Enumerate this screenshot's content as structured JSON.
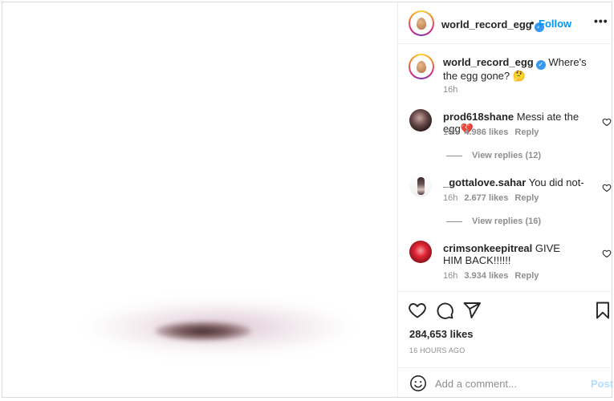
{
  "post": {
    "username": "world_record_egg",
    "verified_mark": "✓",
    "separator": "•",
    "follow_label": "Follow",
    "more_label": "•••",
    "caption_text": "Where's the egg gone? 🤔",
    "caption_time": "16h"
  },
  "comments": [
    {
      "username": "prod618shane",
      "text": "Messi ate the egg💔",
      "time": "16h",
      "likes": "4.986 likes",
      "reply_label": "Reply",
      "view_replies": "View replies (12)"
    },
    {
      "username": "_gottalove.sahar",
      "text": "You did not-",
      "time": "16h",
      "likes": "2.677 likes",
      "reply_label": "Reply",
      "view_replies": "View replies (16)"
    },
    {
      "username": "crimsonkeepitreal",
      "text": "GIVE HIM BACK!!!!!!",
      "time": "16h",
      "likes": "3.934 likes",
      "reply_label": "Reply"
    }
  ],
  "actions": {
    "likes_count": "284,653 likes",
    "time_ago": "16 HOURS AGO"
  },
  "add_comment": {
    "placeholder": "Add a comment...",
    "post_label": "Post"
  },
  "colors": {
    "link_blue": "#0095f6",
    "post_disabled": "#b2dffc",
    "secondary_text": "#8e8e8e"
  },
  "icons": {
    "like": "heart-icon",
    "comment": "comment-icon",
    "share": "share-icon",
    "save": "bookmark-icon",
    "emoji": "emoji-icon"
  }
}
